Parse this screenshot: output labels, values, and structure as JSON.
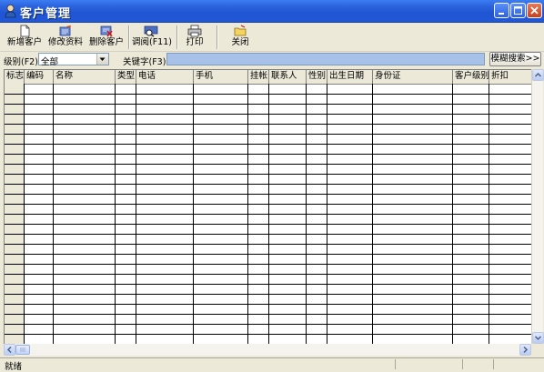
{
  "window": {
    "title": "客户管理",
    "title_icon": "user-icon",
    "controls": [
      "minimize-icon",
      "maximize-icon",
      "close-icon"
    ]
  },
  "toolbar": [
    {
      "label": "新增客户",
      "icon": "new-document-icon"
    },
    {
      "label": "修改资料",
      "icon": "edit-icon"
    },
    {
      "label": "删除客户",
      "icon": "delete-icon"
    },
    {
      "label": "调阅(F11)",
      "icon": "lookup-icon"
    },
    {
      "label": "打印",
      "icon": "printer-icon"
    },
    {
      "label": "关闭",
      "icon": "close-folder-icon"
    }
  ],
  "filter": {
    "level_label": "级别(F2)",
    "level_value": "全部",
    "keyword_label": "关键字(F3)",
    "keyword_value": "",
    "fuzzy_button": "模糊搜索>>"
  },
  "table": {
    "columns": [
      "标志",
      "编码",
      "名称",
      "类型",
      "电话",
      "手机",
      "挂帐",
      "联系人",
      "性别",
      "出生日期",
      "身份证",
      "客户级别",
      "折扣"
    ],
    "rows": []
  },
  "status": {
    "text": "就绪"
  },
  "colors": {
    "titlebar": "#2b63dd",
    "keyword_highlight": "#a7c1e9",
    "face": "#ece9d8"
  }
}
